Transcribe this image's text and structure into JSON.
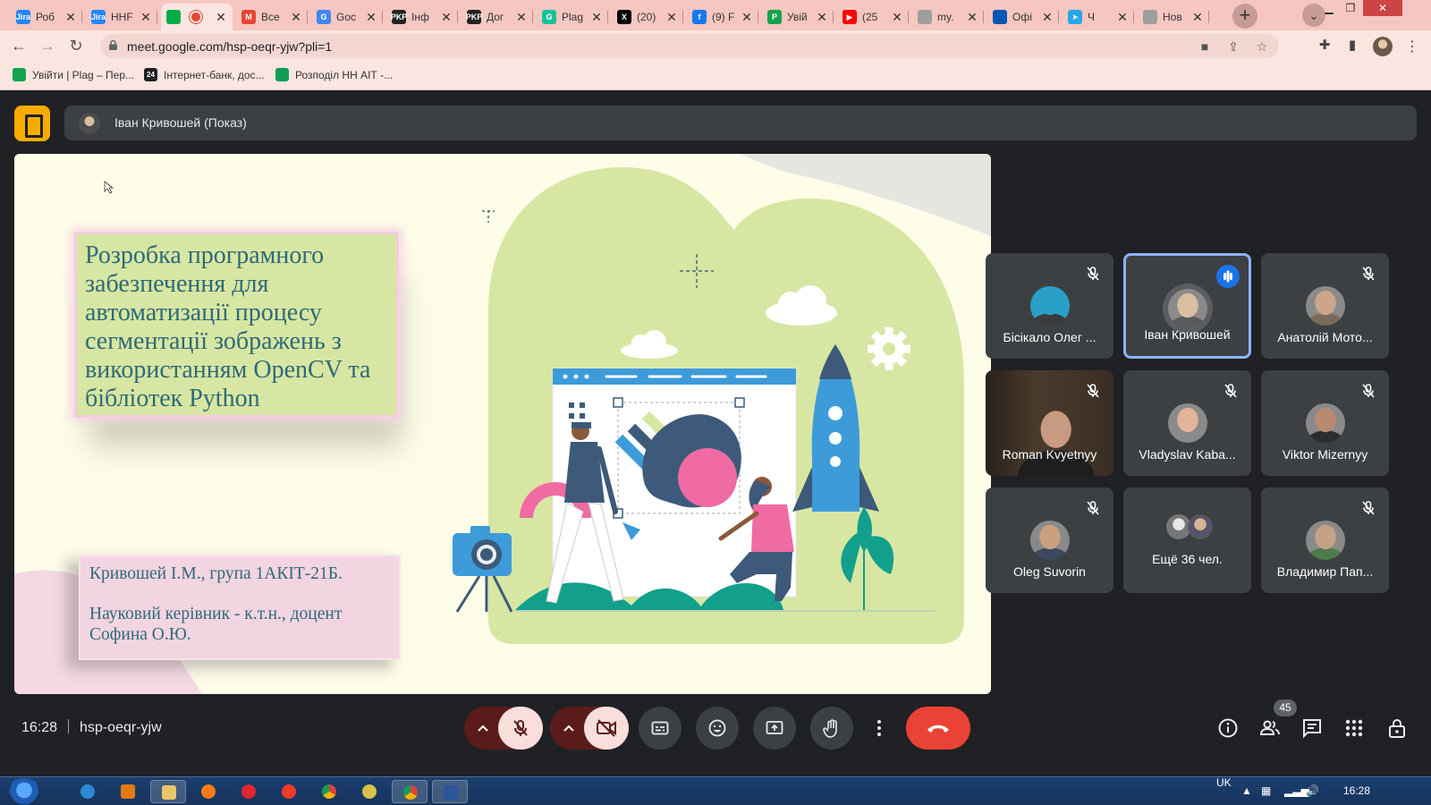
{
  "tabs": [
    {
      "title": "Роб",
      "favicon": "jira-icon",
      "color": "#2684ff",
      "glyph": "Jira"
    },
    {
      "title": "HHF",
      "favicon": "jira-icon",
      "color": "#2684ff",
      "glyph": "Jira"
    },
    {
      "title": "",
      "favicon": "google-meet-icon",
      "color": "#00ac47",
      "glyph": "",
      "active": true,
      "recording": true
    },
    {
      "title": "Все",
      "favicon": "gmail-icon",
      "color": "#ea4335",
      "glyph": "M"
    },
    {
      "title": "Goc",
      "favicon": "google-translate-icon",
      "color": "#4285f4",
      "glyph": "G"
    },
    {
      "title": "Інф",
      "favicon": "pkp-icon",
      "color": "#222222",
      "glyph": "PKP"
    },
    {
      "title": "Дог",
      "favicon": "pkp-icon",
      "color": "#222222",
      "glyph": "PKP"
    },
    {
      "title": "Plag",
      "favicon": "grammarly-icon",
      "color": "#15c39a",
      "glyph": "G"
    },
    {
      "title": "(20)",
      "favicon": "x-twitter-icon",
      "color": "#000000",
      "glyph": "X"
    },
    {
      "title": "(9) F",
      "favicon": "facebook-icon",
      "color": "#1877f2",
      "glyph": "f"
    },
    {
      "title": "Увій",
      "favicon": "plag-icon",
      "color": "#14a44d",
      "glyph": "P"
    },
    {
      "title": "(25",
      "favicon": "youtube-icon",
      "color": "#ff0000",
      "glyph": "▶"
    },
    {
      "title": "my.",
      "favicon": "globe-icon",
      "color": "#9e9e9e",
      "glyph": ""
    },
    {
      "title": "Офі",
      "favicon": "ukraine-icon",
      "color": "#0057b7",
      "glyph": ""
    },
    {
      "title": "Ч",
      "favicon": "telegram-icon",
      "color": "#27a7e7",
      "glyph": "➤"
    },
    {
      "title": "Нов",
      "favicon": "globe-icon",
      "color": "#9e9e9e",
      "glyph": ""
    }
  ],
  "url": "meet.google.com/hsp-oeqr-yjw?pli=1",
  "bookmarks": [
    {
      "label": "Увійти | Plag – Пер...",
      "icon": "plag-icon",
      "color": "#14a44d"
    },
    {
      "label": "Інтернет-банк, дос...",
      "icon": "bank-24-icon",
      "color": "#222222",
      "glyph": "24"
    },
    {
      "label": "Розподіл НН АІТ -...",
      "icon": "google-sheets-icon",
      "color": "#0f9d58"
    }
  ],
  "presenter": {
    "name": "Іван Кривошей (Показ)"
  },
  "slide": {
    "title": "Розробка програмного забезпечення для автоматизації процесу сегментації зображень з використанням OpenCV та бібліотек Python",
    "author": "Кривошей І.М., група 1АКІТ-21Б.",
    "supervisor": "Науковий керівник - к.т.н., доцент Софина О.Ю."
  },
  "participants": [
    {
      "name": "Бісікало Олег ...",
      "muted": true
    },
    {
      "name": "Іван Кривошей",
      "muted": false,
      "speaking": true
    },
    {
      "name": "Анатолій Мото...",
      "muted": true
    },
    {
      "name": "Roman Kvyetnyy",
      "muted": true,
      "video": true
    },
    {
      "name": "Vladyslav Kaba...",
      "muted": true
    },
    {
      "name": "Viktor Mizernyy",
      "muted": true
    },
    {
      "name": "Oleg Suvorin",
      "muted": true
    },
    {
      "name": "Ещё 36 чел.",
      "muted": false,
      "more": true
    },
    {
      "name": "Владимир Пап...",
      "muted": true
    }
  ],
  "meeting": {
    "time": "16:28",
    "code": "hsp-oeqr-yjw",
    "people_count": "45"
  },
  "taskbar": {
    "lang": "UK",
    "time": "16:28"
  },
  "colors": {
    "accent": "#8ab4f8",
    "end_call": "#ea4335",
    "off_state": "#f9dedc"
  }
}
